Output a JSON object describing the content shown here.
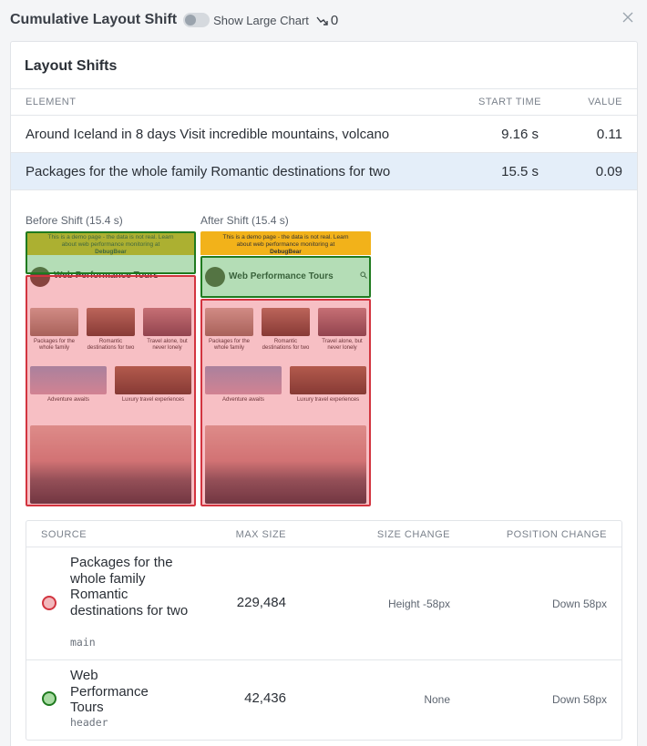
{
  "header": {
    "title": "Cumulative Layout Shift",
    "toggle_label": "Show Large Chart",
    "trend_icon": "trend-down-icon",
    "trend_value": "0",
    "close_icon": "close-icon"
  },
  "layout_shifts": {
    "title": "Layout Shifts",
    "columns": {
      "element": "ELEMENT",
      "start_time": "START TIME",
      "value": "VALUE"
    },
    "rows": [
      {
        "element": "Around Iceland in 8 days Visit incredible mountains, volcano",
        "start_time": "9.16 s",
        "value": "0.11",
        "selected": false
      },
      {
        "element": "Packages for the whole family Romantic destinations for two",
        "start_time": "15.5 s",
        "value": "0.09",
        "selected": true
      }
    ]
  },
  "snapshots": {
    "before_label": "Before Shift (15.4 s)",
    "after_label": "After Shift (15.4 s)",
    "demo_banner_line1": "This is a demo page - the data is not real. Learn",
    "demo_banner_line2": "about web performance monitoring at",
    "demo_banner_brand": "DebugBear",
    "site_name": "Web Performance Tours",
    "cards": [
      {
        "caption": "Packages for the whole family"
      },
      {
        "caption": "Romantic destinations for two"
      },
      {
        "caption": "Travel alone, but never lonely"
      },
      {
        "caption": "Adventure awaits"
      },
      {
        "caption": "Luxury travel experiences"
      }
    ],
    "colors": {
      "shifted_main": "#e63946",
      "shifted_header": "#2a9d2a",
      "banner": "#f2b21a"
    }
  },
  "sources": {
    "columns": {
      "source": "SOURCE",
      "max_size": "MAX SIZE",
      "size_change": "SIZE CHANGE",
      "position_change": "POSITION CHANGE"
    },
    "rows": [
      {
        "name": "Packages for the whole family Romantic destinations for two",
        "tag": "main",
        "max_size": "229,484",
        "size_change": "Height -58px",
        "position_change": "Down 58px",
        "color": "#f2b8bc",
        "border": "#d2343f"
      },
      {
        "name": "Web Performance Tours",
        "tag": "header",
        "max_size": "42,436",
        "size_change": "None",
        "position_change": "Down 58px",
        "color": "#a9dba3",
        "border": "#1f7a1f"
      }
    ]
  }
}
